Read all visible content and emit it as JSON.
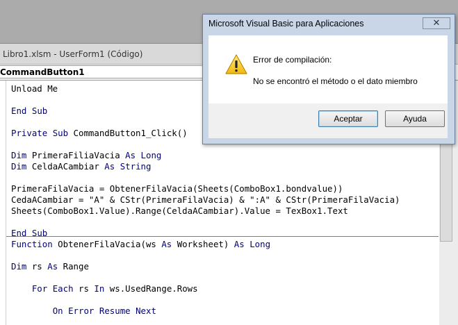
{
  "code_window": {
    "title": "Libro1.xlsm - UserForm1 (Código)",
    "object_dropdown": "CommandButton1"
  },
  "code_lines": [
    {
      "text": "Unload Me"
    },
    {
      "text": ""
    },
    {
      "text": "End Sub"
    },
    {
      "text": ""
    },
    {
      "text": "Private Sub CommandButton1_Click()"
    },
    {
      "text": ""
    },
    {
      "text": "Dim PrimeraFiliaVacia As Long"
    },
    {
      "text": "Dim CeldaACambiar As String"
    },
    {
      "text": ""
    },
    {
      "text": "PrimeraFilaVacia = ObtenerFilaVacia(Sheets(ComboBox1.bondvalue))"
    },
    {
      "text": "CedaACambiar = \"A\" & CStr(PrimeraFilaVacia) & \":A\" & CStr(PrimeraFilaVacia)"
    },
    {
      "text": "Sheets(ComboBox1.Value).Range(CeldaACambiar).Value = TexBox1.Text"
    },
    {
      "text": ""
    },
    {
      "text": "End Sub"
    },
    {
      "text": "Function ObtenerFilaVacia(ws As Worksheet) As Long"
    },
    {
      "text": ""
    },
    {
      "text": "Dim rs As Range"
    },
    {
      "text": ""
    },
    {
      "text": "    For Each rs In ws.UsedRange.Rows"
    },
    {
      "text": ""
    },
    {
      "text": "        On Error Resume Next"
    }
  ],
  "dialog": {
    "title": "Microsoft Visual Basic para Aplicaciones",
    "close_symbol": "✕",
    "icon": "warning-icon",
    "message_title": "Error de compilación:",
    "message_detail": "No se encontró el método o el dato miembro",
    "ok_label": "Aceptar",
    "help_label": "Ayuda"
  },
  "colors": {
    "keyword": "#00007f",
    "dialog_frame": "#c8d6e8",
    "ok_button_focus": "#3c7fb1"
  }
}
